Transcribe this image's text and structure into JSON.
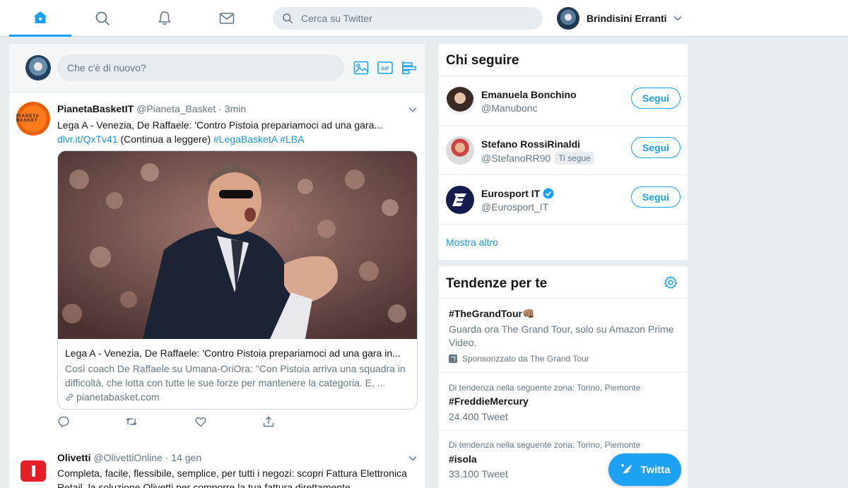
{
  "nav": {
    "items": [
      {
        "name": "home",
        "icon": "home-icon",
        "active": true
      },
      {
        "name": "explore",
        "icon": "search-icon"
      },
      {
        "name": "notifications",
        "icon": "bell-icon"
      },
      {
        "name": "messages",
        "icon": "envelope-icon"
      }
    ],
    "search_placeholder": "Cerca su Twitter",
    "account_name": "Brindisini Erranti"
  },
  "composer": {
    "placeholder": "Che c'è di nuovo?",
    "tools": [
      "image-icon",
      "gif-icon",
      "poll-icon"
    ],
    "gif_label": "GIF"
  },
  "tweets": [
    {
      "name": "PianetaBasketIT",
      "handle": "@Pianeta_Basket",
      "dot": "·",
      "time": "3min",
      "avatar_text": "PIANETA BASKET",
      "text_main": "Lega A - Venezia, De Raffaele: 'Contro Pistoia prepariamoci ad una gara...",
      "link": "dlvr.it/QxTv41",
      "text_after_link": " (Continua a leggere) ",
      "hashtag1": "#LegaBasketA",
      "hashtag2": "#LBA",
      "card": {
        "title": "Lega A - Venezia, De Raffaele: 'Contro Pistoia prepariamoci ad una gara in...",
        "description": "Così coach De Raffaele su Umana-OriOra: \"Con Pistoia arriva una squadra in difficoltà, che lotta con tutte le sue forze per mantenere la categoria. E, ...",
        "domain": "pianetabasket.com"
      },
      "actions": [
        "reply-icon",
        "retweet-icon",
        "like-icon",
        "share-icon"
      ]
    },
    {
      "name": "Olivetti",
      "handle": "@OlivettiOnline",
      "dot": "·",
      "time": "14 gen",
      "text": "Completa, facile, flessibile, semplice, per tutti i negozi: scopri Fattura Elettronica Retail, la soluzione Olivetti per comporre la tua fattura direttamente"
    }
  ],
  "who_to_follow": {
    "title": "Chi seguire",
    "users": [
      {
        "name": "Emanuela Bonchino",
        "handle": "@Manubonc",
        "button": "Segui"
      },
      {
        "name": "Stefano RossiRinaldi",
        "handle": "@StefanoRR90",
        "badge": "Ti segue",
        "button": "Segui"
      },
      {
        "name": "Eurosport IT",
        "handle": "@Eurosport_IT",
        "verified": true,
        "button": "Segui"
      }
    ],
    "more": "Mostra altro"
  },
  "trends": {
    "title": "Tendenze per te",
    "items": [
      {
        "name": "#TheGrandTour👊🏽",
        "description": "Guarda ora The Grand Tour, solo su Amazon Prime Video.",
        "promoted": "Sponsorizzato da The Grand Tour"
      },
      {
        "context": "Di tendenza nella seguente zona: Torino, Piemonte",
        "name": "#FreddieMercury",
        "count": "24.400 Tweet"
      },
      {
        "context": "Di tendenza nella seguente zona: Torino, Piemonte",
        "name": "#isola",
        "count": "33.100 Tweet"
      }
    ]
  },
  "tweet_button": "Twitta",
  "colors": {
    "accent": "#1da1f2",
    "link": "#1b95e0",
    "background": "#e6ecf0",
    "secondary_text": "#657786"
  }
}
